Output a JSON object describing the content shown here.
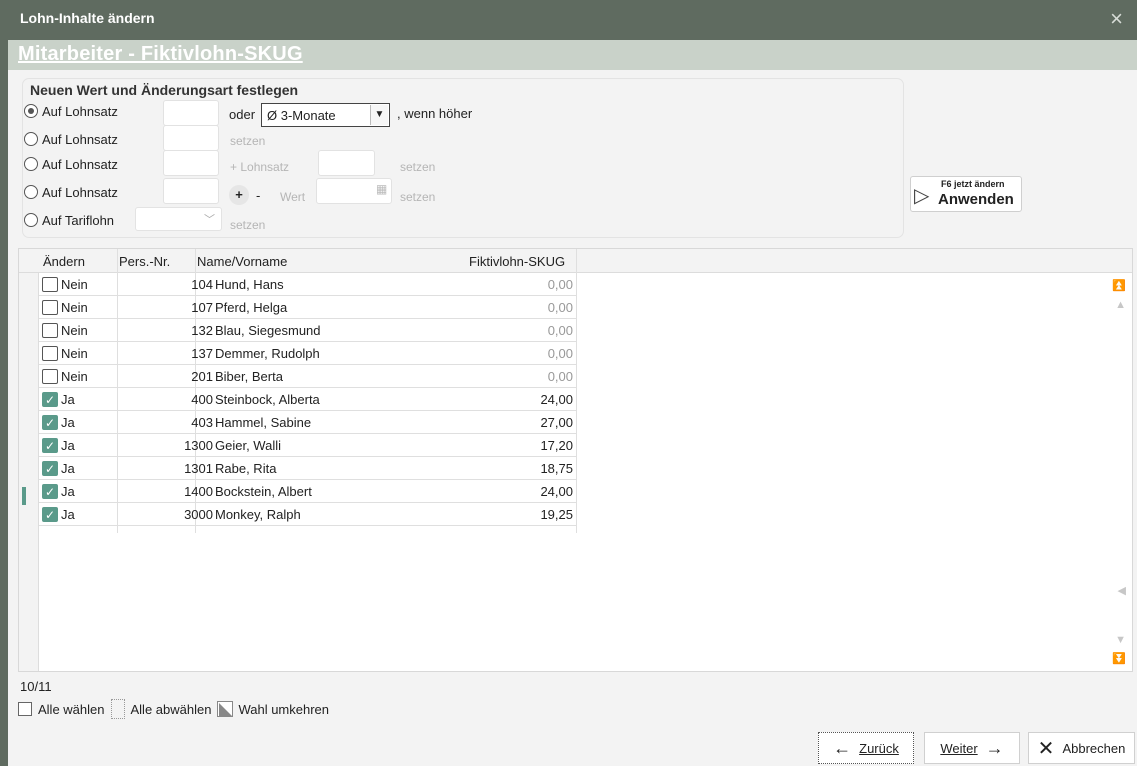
{
  "window": {
    "title": "Lohn-Inhalte ändern",
    "close_icon": "×"
  },
  "header": {
    "title": "Mitarbeiter - Fiktivlohn-SKUG"
  },
  "panel": {
    "title": "Neuen Wert und Änderungsart festlegen",
    "options": [
      {
        "label": "Auf Lohnsatz",
        "selected": true
      },
      {
        "label": "Auf Lohnsatz",
        "selected": false
      },
      {
        "label": "Auf Lohnsatz",
        "selected": false
      },
      {
        "label": "Auf Lohnsatz",
        "selected": false
      },
      {
        "label": "Auf Tariflohn",
        "selected": false
      }
    ],
    "oder": "oder",
    "select_value": "Ø 3-Monate",
    "wenn_hoeher": ", wenn höher",
    "setzen": "setzen",
    "plus_lohnsatz": "+ Lohnsatz",
    "plus": "+",
    "minus": "-",
    "wert": "Wert",
    "apply_small": "F6 jetzt ändern",
    "apply_label": "Anwenden"
  },
  "table": {
    "columns": [
      "Ändern",
      "Pers.-Nr.",
      "Name/Vorname",
      "Fiktivlohn-SKUG"
    ],
    "rows": [
      {
        "checked": false,
        "aendern": "Nein",
        "nr": "104",
        "name": "Hund, Hans",
        "value": "0,00"
      },
      {
        "checked": false,
        "aendern": "Nein",
        "nr": "107",
        "name": "Pferd, Helga",
        "value": "0,00"
      },
      {
        "checked": false,
        "aendern": "Nein",
        "nr": "132",
        "name": "Blau, Siegesmund",
        "value": "0,00"
      },
      {
        "checked": false,
        "aendern": "Nein",
        "nr": "137",
        "name": "Demmer, Rudolph",
        "value": "0,00"
      },
      {
        "checked": false,
        "aendern": "Nein",
        "nr": "201",
        "name": "Biber, Berta",
        "value": "0,00"
      },
      {
        "checked": true,
        "aendern": "Ja",
        "nr": "400",
        "name": "Steinbock, Alberta",
        "value": "24,00"
      },
      {
        "checked": true,
        "aendern": "Ja",
        "nr": "403",
        "name": "Hammel, Sabine",
        "value": "27,00"
      },
      {
        "checked": true,
        "aendern": "Ja",
        "nr": "1300",
        "name": "Geier, Walli",
        "value": "17,20"
      },
      {
        "checked": true,
        "aendern": "Ja",
        "nr": "1301",
        "name": "Rabe, Rita",
        "value": "18,75"
      },
      {
        "checked": true,
        "aendern": "Ja",
        "nr": "1400",
        "name": "Bockstein, Albert",
        "value": "24,00"
      },
      {
        "checked": true,
        "aendern": "Ja",
        "nr": "3000",
        "name": "Monkey, Ralph",
        "value": "19,25"
      }
    ],
    "count": "10/11"
  },
  "selection": {
    "select_all": "Alle wählen",
    "deselect_all": "Alle abwählen",
    "invert": "Wahl umkehren"
  },
  "buttons": {
    "back": "Zurück",
    "next": "Weiter",
    "cancel": "Abbrechen"
  }
}
